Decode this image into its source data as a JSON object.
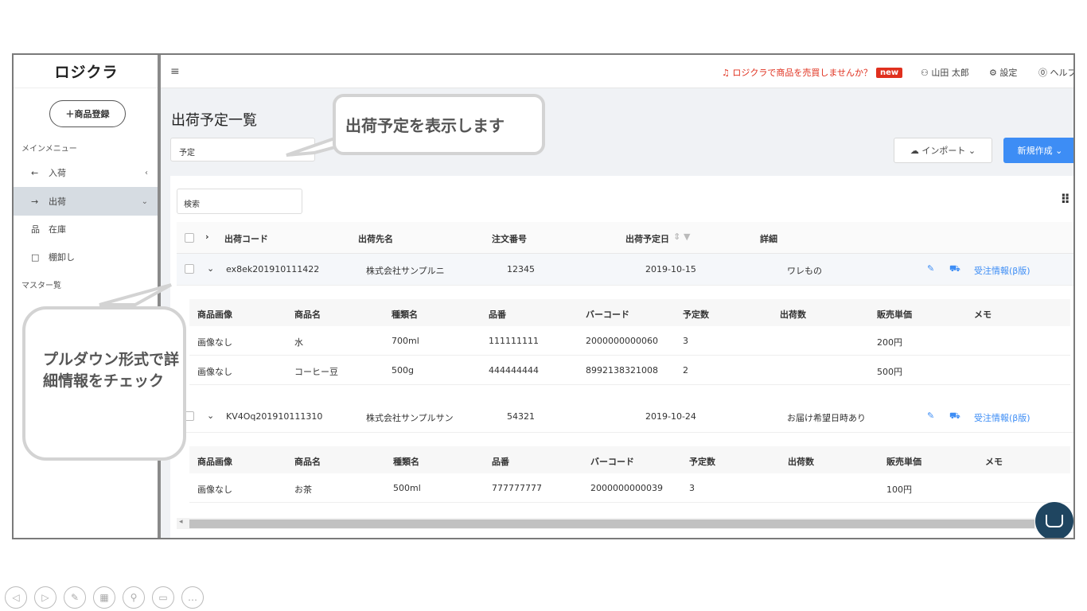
{
  "app": {
    "logo": "ロジクラ"
  },
  "topbar": {
    "menu_icon": "≡",
    "promo": "ロジクラで商品を売買しませんか？",
    "promo_badge": "new",
    "user": "山田 太郎",
    "settings": "設定",
    "help": "ヘルプ"
  },
  "sidebar": {
    "add_button": "＋商品登録",
    "main_menu_header": "メインメニュー",
    "master_header": "マスター覧",
    "items": [
      {
        "label": "入荷",
        "icon": "←"
      },
      {
        "label": "出荷",
        "icon": "→"
      },
      {
        "label": "在庫",
        "icon": "品"
      },
      {
        "label": "棚卸し",
        "icon": "□"
      }
    ]
  },
  "page": {
    "title": "出荷予定一覧",
    "filter_value": "予定",
    "import_button": "インポート",
    "create_button": "新規作成",
    "search_placeholder": "検索"
  },
  "table": {
    "columns": [
      "出荷コード",
      "出荷先名",
      "注文番号",
      "出荷予定日",
      "詳細"
    ],
    "rows": [
      {
        "code": "ex8ek201910111422",
        "dest": "株式会社サンプルニ",
        "order": "12345",
        "date": "2019-10-15",
        "detail": "ワレもの",
        "link": "受注情報(β版)",
        "sub_columns": [
          "商品画像",
          "商品名",
          "種類名",
          "品番",
          "バーコード",
          "予定数",
          "出荷数",
          "販売単価",
          "メモ"
        ],
        "sub_rows": [
          [
            "画像なし",
            "水",
            "700ml",
            "111111111",
            "2000000000060",
            "3",
            "",
            "200円",
            ""
          ],
          [
            "画像なし",
            "コーヒー豆",
            "500g",
            "444444444",
            "8992138321008",
            "2",
            "",
            "500円",
            ""
          ]
        ]
      },
      {
        "code": "KV4Oq201910111310",
        "dest": "株式会社サンプルサン",
        "order": "54321",
        "date": "2019-10-24",
        "detail": "お届け希望日時あり",
        "link": "受注情報(β版)",
        "sub_columns": [
          "商品画像",
          "商品名",
          "種類名",
          "品番",
          "バーコード",
          "予定数",
          "出荷数",
          "販売単価",
          "メモ"
        ],
        "sub_rows": [
          [
            "画像なし",
            "お茶",
            "500ml",
            "777777777",
            "2000000000039",
            "3",
            "",
            "100円",
            ""
          ]
        ]
      }
    ]
  },
  "callouts": {
    "top": "出荷予定を表示します",
    "left": "プルダウン形式で詳細情報をチェック"
  },
  "colors": {
    "accent": "#3d8df5",
    "promo": "#e0301e",
    "chat": "#1f4560"
  }
}
